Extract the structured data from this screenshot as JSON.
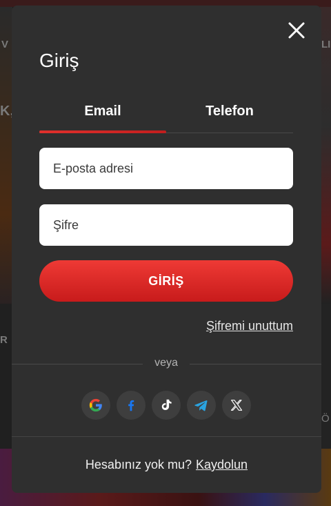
{
  "background": {
    "left_texts": [
      "V",
      "K,",
      "R"
    ],
    "right_texts": [
      "LI",
      "Ö"
    ]
  },
  "modal": {
    "title": "Giriş",
    "tabs": [
      {
        "label": "Email",
        "active": true
      },
      {
        "label": "Telefon",
        "active": false
      }
    ],
    "email_field": {
      "placeholder": "E-posta adresi",
      "value": ""
    },
    "password_field": {
      "placeholder": "Şifre",
      "value": ""
    },
    "login_button": "GİRİŞ",
    "forgot_password": "Şifremi unuttum",
    "divider_text": "veya",
    "social_icons": [
      "google-icon",
      "facebook-icon",
      "tiktok-icon",
      "telegram-icon",
      "x-icon"
    ],
    "footer": {
      "question": "Hesabınız yok mu?",
      "signup_link": "Kaydolun"
    },
    "colors": {
      "accent": "#e0302c",
      "modal_bg": "#2f2f2f"
    }
  }
}
